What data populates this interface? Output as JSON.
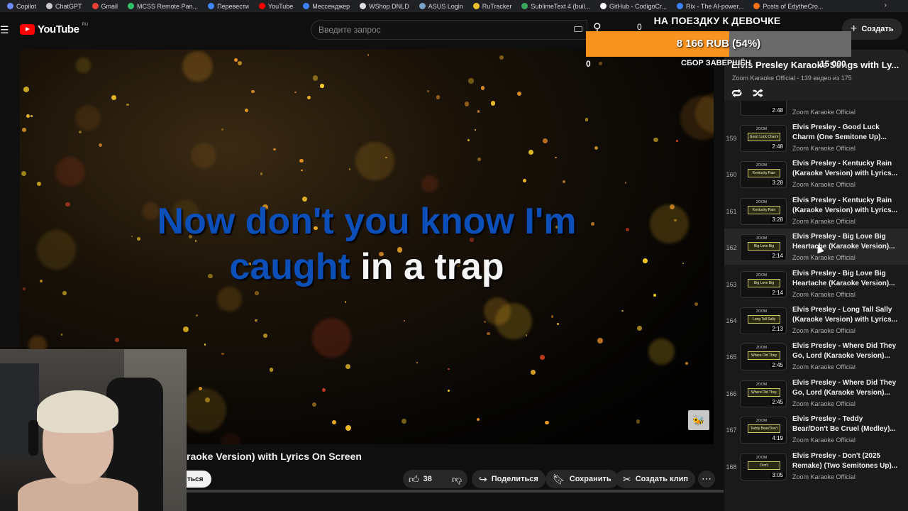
{
  "bookmarks": [
    {
      "label": "Copilot",
      "color": "#6b8bff"
    },
    {
      "label": "ChatGPT",
      "color": "#cccccc"
    },
    {
      "label": "Gmail",
      "color": "#ea4335"
    },
    {
      "label": "MCSS Remote Pan...",
      "color": "#33c26b"
    },
    {
      "label": "Перевести",
      "color": "#4285f4"
    },
    {
      "label": "YouTube",
      "color": "#ff0000"
    },
    {
      "label": "Мессенджер",
      "color": "#3b82f6"
    },
    {
      "label": "WShop DNLD",
      "color": "#e0e0e0"
    },
    {
      "label": "ASUS Login",
      "color": "#7aa3c8"
    },
    {
      "label": "RuTracker",
      "color": "#f2c12e"
    },
    {
      "label": "SublimeText 4 (buil...",
      "color": "#3ba55c"
    },
    {
      "label": "GitHub - CodigoCr...",
      "color": "#ffffff"
    },
    {
      "label": "Rix - The AI-power...",
      "color": "#3b82f6"
    },
    {
      "label": "Posts of EdytheCro...",
      "color": "#f97316"
    }
  ],
  "masthead": {
    "logo_text": "YouTube",
    "logo_region": "RU",
    "search_placeholder": "Введите запрос",
    "create_label": "Создать",
    "notification_count": "0"
  },
  "player": {
    "lyric_line1_blue": "Now don't you know I'm",
    "lyric_line2_blue": "caught",
    "lyric_line2_white": "in a trap"
  },
  "video": {
    "title": "raoke Version) with Lyrics On Screen",
    "subscribe_label": "ться",
    "like_count": "38",
    "share_label": "Поделиться",
    "save_label": "Сохранить",
    "clip_label": "Создать клип"
  },
  "donation": {
    "goal_title": "НА ПОЕЗДКУ К ДЕВОЧКЕ",
    "amount_text": "8 166 RUB (54%)",
    "progress": 0.54,
    "start_value": "0",
    "status": "СБОР ЗАВЕРШЁН",
    "target_value": "15 000",
    "fill_color": "#f7931e"
  },
  "playlist": {
    "title": "Elvis Presley Karaoke Songs with Ly...",
    "subtitle": "Zoom Karaoke Official - 139 видео из 175",
    "partial_item": {
      "duration": "2:48",
      "channel": "Zoom Karaoke Official"
    },
    "items": [
      {
        "index": "159",
        "title": "Elvis Presley - Good Luck Charm (One Semitone Up)...",
        "channel": "Zoom Karaoke Official",
        "duration": "2:48",
        "thumb_text": "Good Luck Charm",
        "active": false
      },
      {
        "index": "160",
        "title": "Elvis Presley - Kentucky Rain (Karaoke Version) with Lyrics...",
        "channel": "Zoom Karaoke Official",
        "duration": "3:28",
        "thumb_text": "Kentucky Rain",
        "active": false
      },
      {
        "index": "161",
        "title": "Elvis Presley - Kentucky Rain (Karaoke Version) with Lyrics...",
        "channel": "Zoom Karaoke Official",
        "duration": "3:28",
        "thumb_text": "Kentucky Rain",
        "active": false
      },
      {
        "index": "162",
        "title": "Elvis Presley - Big Love Big Heartache (Karaoke Version)...",
        "channel": "Zoom Karaoke Official",
        "duration": "2:14",
        "thumb_text": "Big Love Big Heartache",
        "active": true
      },
      {
        "index": "163",
        "title": "Elvis Presley - Big Love Big Heartache (Karaoke Version)...",
        "channel": "Zoom Karaoke Official",
        "duration": "2:14",
        "thumb_text": "Big Love Big Heartache",
        "active": false
      },
      {
        "index": "164",
        "title": "Elvis Presley - Long Tall Sally (Karaoke Version) with Lyrics...",
        "channel": "Zoom Karaoke Official",
        "duration": "2:13",
        "thumb_text": "Long Tall Sally",
        "active": false
      },
      {
        "index": "165",
        "title": "Elvis Presley - Where Did They Go, Lord (Karaoke Version)...",
        "channel": "Zoom Karaoke Official",
        "duration": "2:45",
        "thumb_text": "Where Did They Go, Lord",
        "active": false
      },
      {
        "index": "166",
        "title": "Elvis Presley - Where Did They Go, Lord (Karaoke Version)...",
        "channel": "Zoom Karaoke Official",
        "duration": "2:45",
        "thumb_text": "Where Did They Go, Lord",
        "active": false
      },
      {
        "index": "167",
        "title": "Elvis Presley - Teddy Bear/Don't Be Cruel (Medley)...",
        "channel": "Zoom Karaoke Official",
        "duration": "4:19",
        "thumb_text": "Teddy Bear/Don't Be Cruel",
        "active": false
      },
      {
        "index": "168",
        "title": "Elvis Presley - Don't (2025 Remake) (Two Semitones Up)...",
        "channel": "Zoom Karaoke Official",
        "duration": "3:05",
        "thumb_text": "Don't",
        "active": false
      }
    ]
  }
}
